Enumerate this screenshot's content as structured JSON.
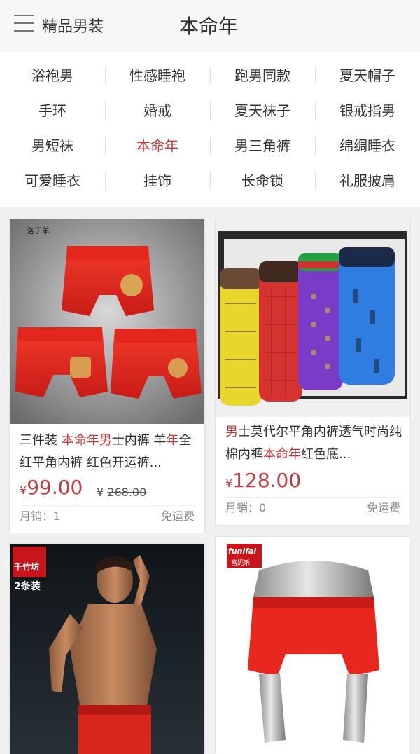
{
  "header": {
    "menu_icon": "hamburger-menu-icon",
    "brand": "精品男装",
    "title": "本命年"
  },
  "categories": {
    "active_color": "#c23b3b",
    "rows": [
      [
        "浴袍男",
        "性感睡袍",
        "跑男同款",
        "夏天帽子"
      ],
      [
        "手环",
        "婚戒",
        "夏天袜子",
        "银戒指男"
      ],
      [
        "男短袜",
        "本命年",
        "男三角裤",
        "绵绸睡衣"
      ],
      [
        "可爱睡衣",
        "挂饰",
        "长命锁",
        "礼服披肩"
      ]
    ]
  },
  "products": [
    {
      "image": "red-boxer-briefs-3-pack-photo",
      "image_brand": "洛丁羊",
      "title_parts": [
        {
          "text": "三件装 ",
          "hl": false
        },
        {
          "text": "本命年男",
          "hl": true
        },
        {
          "text": "士内裤 羊",
          "hl": false
        },
        {
          "text": "年",
          "hl": true
        },
        {
          "text": "全红平角内裤 红色开运裤...",
          "hl": false
        }
      ],
      "currency": "¥",
      "price": "99.00",
      "original_price": "268.00",
      "sales": "月销：1",
      "shipping": "免运费"
    },
    {
      "image": "patterned-boxer-briefs-gift-box-photo",
      "title_parts": [
        {
          "text": "男",
          "hl": true
        },
        {
          "text": "士莫代尔平角内裤透气时尚纯棉内裤",
          "hl": false
        },
        {
          "text": "本命年",
          "hl": true
        },
        {
          "text": "红色底...",
          "hl": false
        }
      ],
      "currency": "¥",
      "price": "128.00",
      "sales": "月销：0",
      "shipping": "免运费"
    },
    {
      "image": "male-model-red-underwear-photo",
      "image_brand": "千竹坊",
      "image_tag": "2条装"
    },
    {
      "image": "red-briefs-on-mannequin-photo",
      "image_brand": "funifal",
      "image_brand_sub": "富妮禾"
    }
  ]
}
